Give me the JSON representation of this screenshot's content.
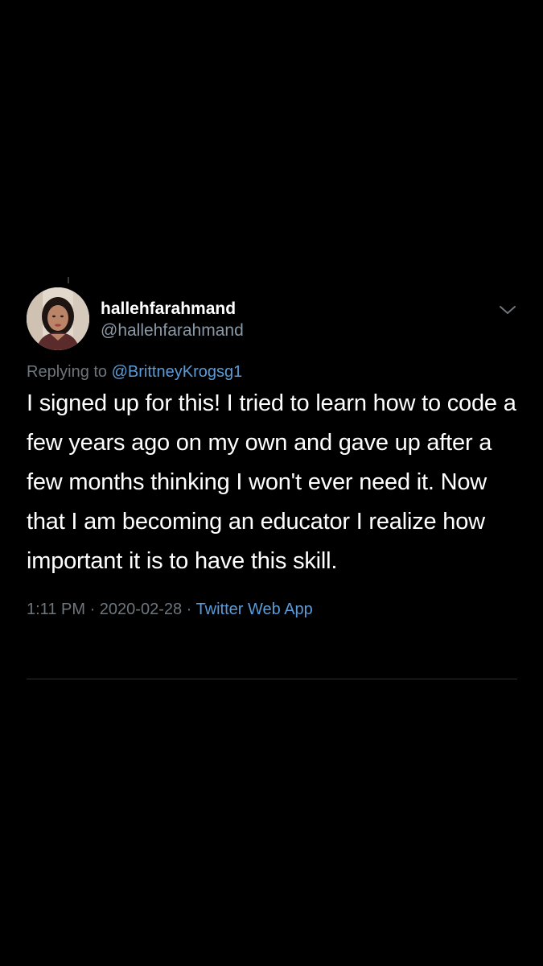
{
  "colors": {
    "background": "#000000",
    "text": "#ffffff",
    "muted": "#6e767d",
    "link": "#5a9bd8",
    "divider": "#2b2e31"
  },
  "tweet": {
    "display_name": "hallehfarahmand",
    "handle": "@hallehfarahmand",
    "avatar_icon": "profile-photo",
    "menu_icon": "chevron-down-icon",
    "replying_to_label": "Replying to",
    "replying_to_handle": "@BrittneyKrogsg1",
    "text": "I signed up for this! I tried to learn how to code a few years ago on my own and gave up after a few months thinking I won't ever need it. Now that I am becoming an educator I realize how important it is to have this skill.",
    "time": "1:11 PM",
    "separator": "·",
    "date": "2020-02-28",
    "source": "Twitter Web App"
  }
}
